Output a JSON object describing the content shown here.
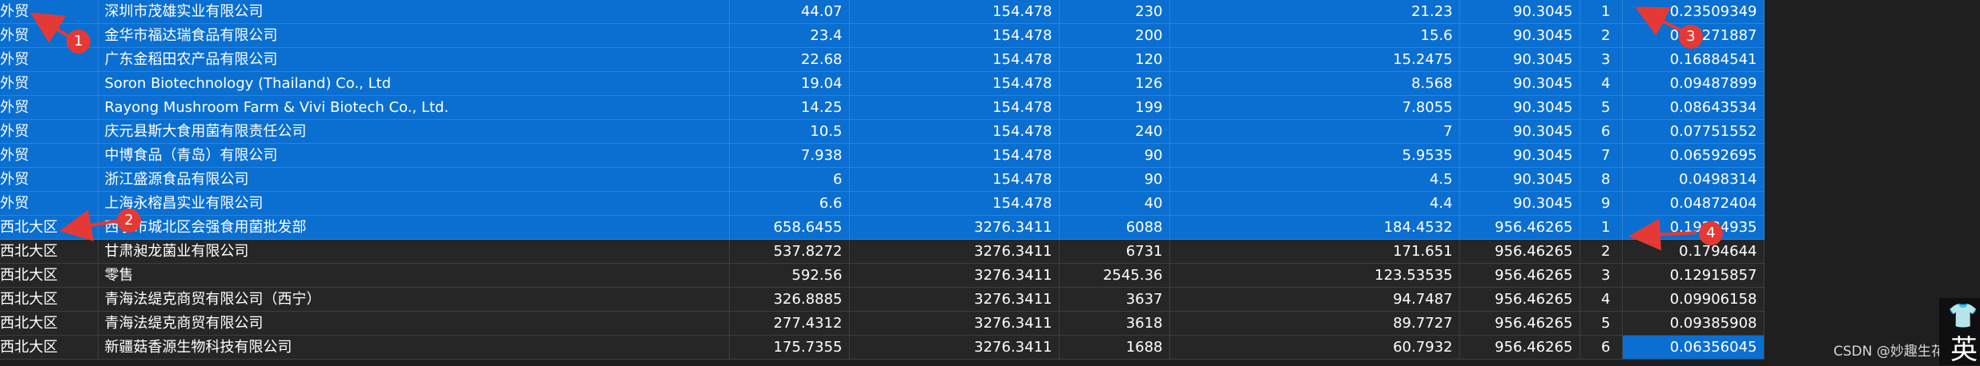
{
  "rows": [
    {
      "region": "外贸",
      "company": "深圳市茂雄实业有限公司",
      "v1": "44.07",
      "v2": "154.478",
      "v3": "230",
      "v4": "21.23",
      "v5": "90.3045",
      "rank": "1",
      "ratio": "0.23509349",
      "selected": true
    },
    {
      "region": "外贸",
      "company": "金华市福达瑞食品有限公司",
      "v1": "23.4",
      "v2": "154.478",
      "v3": "200",
      "v4": "15.6",
      "v5": "90.3045",
      "rank": "2",
      "ratio": "0.17271887",
      "selected": true
    },
    {
      "region": "外贸",
      "company": "广东金稻田农产品有限公司",
      "v1": "22.68",
      "v2": "154.478",
      "v3": "120",
      "v4": "15.2475",
      "v5": "90.3045",
      "rank": "3",
      "ratio": "0.16884541",
      "selected": true
    },
    {
      "region": "外贸",
      "company": "Soron Biotechnology (Thailand) Co., Ltd",
      "v1": "19.04",
      "v2": "154.478",
      "v3": "126",
      "v4": "8.568",
      "v5": "90.3045",
      "rank": "4",
      "ratio": "0.09487899",
      "selected": true
    },
    {
      "region": "外贸",
      "company": "Rayong Mushroom Farm & Vivi Biotech Co., Ltd.",
      "v1": "14.25",
      "v2": "154.478",
      "v3": "199",
      "v4": "7.8055",
      "v5": "90.3045",
      "rank": "5",
      "ratio": "0.08643534",
      "selected": true
    },
    {
      "region": "外贸",
      "company": "庆元县斯大食用菌有限责任公司",
      "v1": "10.5",
      "v2": "154.478",
      "v3": "240",
      "v4": "7",
      "v5": "90.3045",
      "rank": "6",
      "ratio": "0.07751552",
      "selected": true
    },
    {
      "region": "外贸",
      "company": "中博食品（青岛）有限公司",
      "v1": "7.938",
      "v2": "154.478",
      "v3": "90",
      "v4": "5.9535",
      "v5": "90.3045",
      "rank": "7",
      "ratio": "0.06592695",
      "selected": true
    },
    {
      "region": "外贸",
      "company": "浙江盛源食品有限公司",
      "v1": "6",
      "v2": "154.478",
      "v3": "90",
      "v4": "4.5",
      "v5": "90.3045",
      "rank": "8",
      "ratio": "0.0498314",
      "selected": true
    },
    {
      "region": "外贸",
      "company": "上海永榕昌实业有限公司",
      "v1": "6.6",
      "v2": "154.478",
      "v3": "40",
      "v4": "4.4",
      "v5": "90.3045",
      "rank": "9",
      "ratio": "0.04872404",
      "selected": true
    },
    {
      "region": "西北大区",
      "company": "西宁市城北区会强食用菌批发部",
      "v1": "658.6455",
      "v2": "3276.3411",
      "v3": "6088",
      "v4": "184.4532",
      "v5": "956.46265",
      "rank": "1",
      "ratio": "0.19284935",
      "selected": true
    },
    {
      "region": "西北大区",
      "company": "甘肃昶龙菌业有限公司",
      "v1": "537.8272",
      "v2": "3276.3411",
      "v3": "6731",
      "v4": "171.651",
      "v5": "956.46265",
      "rank": "2",
      "ratio": "0.1794644",
      "selected": false
    },
    {
      "region": "西北大区",
      "company": "零售",
      "v1": "592.56",
      "v2": "3276.3411",
      "v3": "2545.36",
      "v4": "123.53535",
      "v5": "956.46265",
      "rank": "3",
      "ratio": "0.12915857",
      "selected": false
    },
    {
      "region": "西北大区",
      "company": "青海法缇克商贸有限公司（西宁）",
      "v1": "326.8885",
      "v2": "3276.3411",
      "v3": "3637",
      "v4": "94.7487",
      "v5": "956.46265",
      "rank": "4",
      "ratio": "0.09906158",
      "selected": false
    },
    {
      "region": "西北大区",
      "company": "青海法缇克商贸有限公司",
      "v1": "277.4312",
      "v2": "3276.3411",
      "v3": "3618",
      "v4": "89.7727",
      "v5": "956.46265",
      "rank": "5",
      "ratio": "0.09385908",
      "selected": false
    },
    {
      "region": "西北大区",
      "company": "新疆菇香源生物科技有限公司",
      "v1": "175.7355",
      "v2": "3276.3411",
      "v3": "1688",
      "v4": "60.7932",
      "v5": "956.46265",
      "rank": "6",
      "ratio": "0.06356045",
      "selected": false,
      "ratio_highlight": true
    }
  ],
  "markers": [
    "1",
    "2",
    "3",
    "4"
  ],
  "watermark": "CSDN @妙趣生花",
  "ime_label": "英",
  "colors": {
    "selection": "#0a6fd1",
    "row_bg": "#262626",
    "page_bg": "#1f1f1f",
    "marker": "#e53935"
  }
}
